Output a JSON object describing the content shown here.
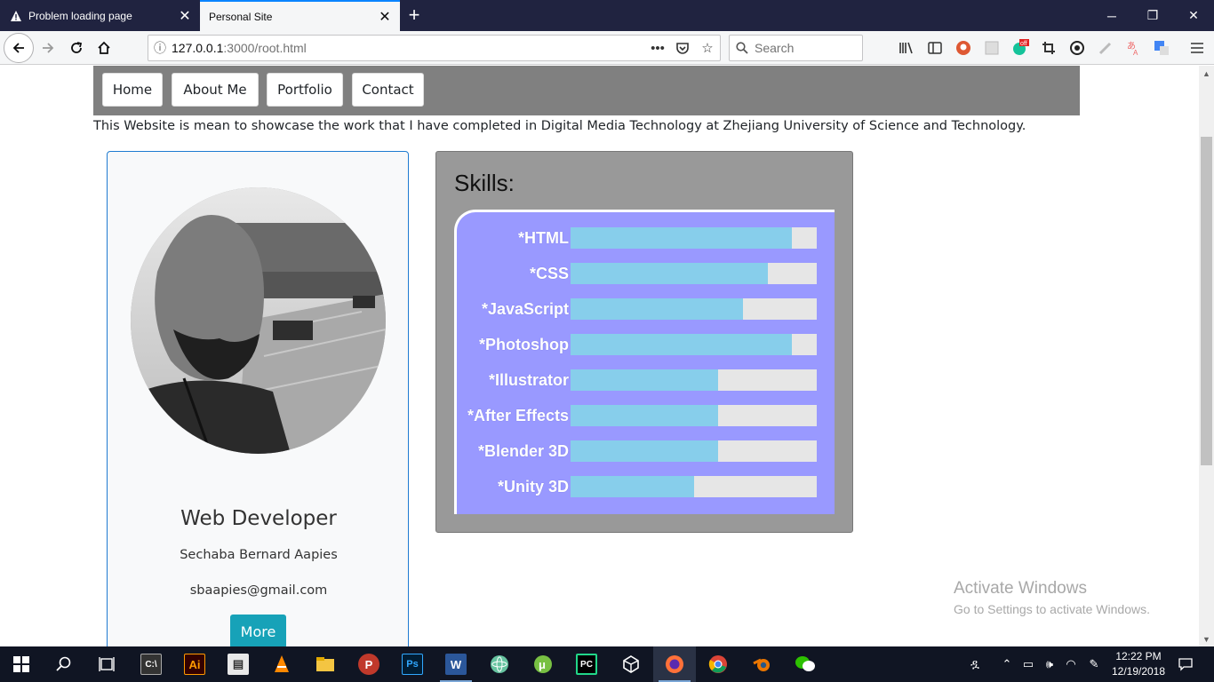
{
  "browser": {
    "tabs": [
      {
        "label": "Problem loading page",
        "icon": "warning-icon",
        "active": false
      },
      {
        "label": "Personal Site",
        "icon": "none",
        "active": true
      }
    ],
    "url_host": "127.0.0.1",
    "url_rest": ":3000/root.html",
    "search_placeholder": "Search",
    "ext_badge": "off"
  },
  "site": {
    "nav": [
      "Home",
      "About Me",
      "Portfolio",
      "Contact"
    ],
    "intro": "This Website is mean to showcase the work that I have completed in Digital Media Technology at Zhejiang University of Science and Technology.",
    "profile": {
      "role": "Web Developer",
      "name": "Sechaba Bernard Aapies",
      "email": "sbaapies@gmail.com",
      "more_label": "More"
    },
    "skills": {
      "title": "Skills:",
      "items": [
        {
          "label": "*HTML",
          "level": 0.9
        },
        {
          "label": "*CSS",
          "level": 0.8
        },
        {
          "label": "*JavaScript",
          "level": 0.7
        },
        {
          "label": "*Photoshop",
          "level": 0.9
        },
        {
          "label": "*Illustrator",
          "level": 0.6
        },
        {
          "label": "*After Effects",
          "level": 0.6
        },
        {
          "label": "*Blender 3D",
          "level": 0.6
        },
        {
          "label": "*Unity 3D",
          "level": 0.5
        }
      ]
    }
  },
  "watermark": {
    "line1": "Activate Windows",
    "line2": "Go to Settings to activate Windows."
  },
  "taskbar": {
    "apps": [
      "start-icon",
      "search-icon",
      "task-view-icon",
      "terminal-icon",
      "illustrator-icon",
      "file-icon",
      "vlc-icon",
      "file-explorer-icon",
      "wps-icon",
      "photoshop-icon",
      "word-icon",
      "atom-icon",
      "utorrent-icon",
      "pycharm-icon",
      "unity-icon",
      "firefox-icon",
      "chrome-icon",
      "blender-icon",
      "wechat-icon"
    ],
    "time": "12:22 PM",
    "date": "12/19/2018"
  },
  "colors": {
    "accent": "#0a84ff",
    "site_nav_bg": "#808080",
    "card_border": "#1f7bd1",
    "more_button": "#17a2b8",
    "skills_bg": "#999999",
    "skills_box": "#9999ff",
    "skill_fill": "#87ceeb"
  }
}
